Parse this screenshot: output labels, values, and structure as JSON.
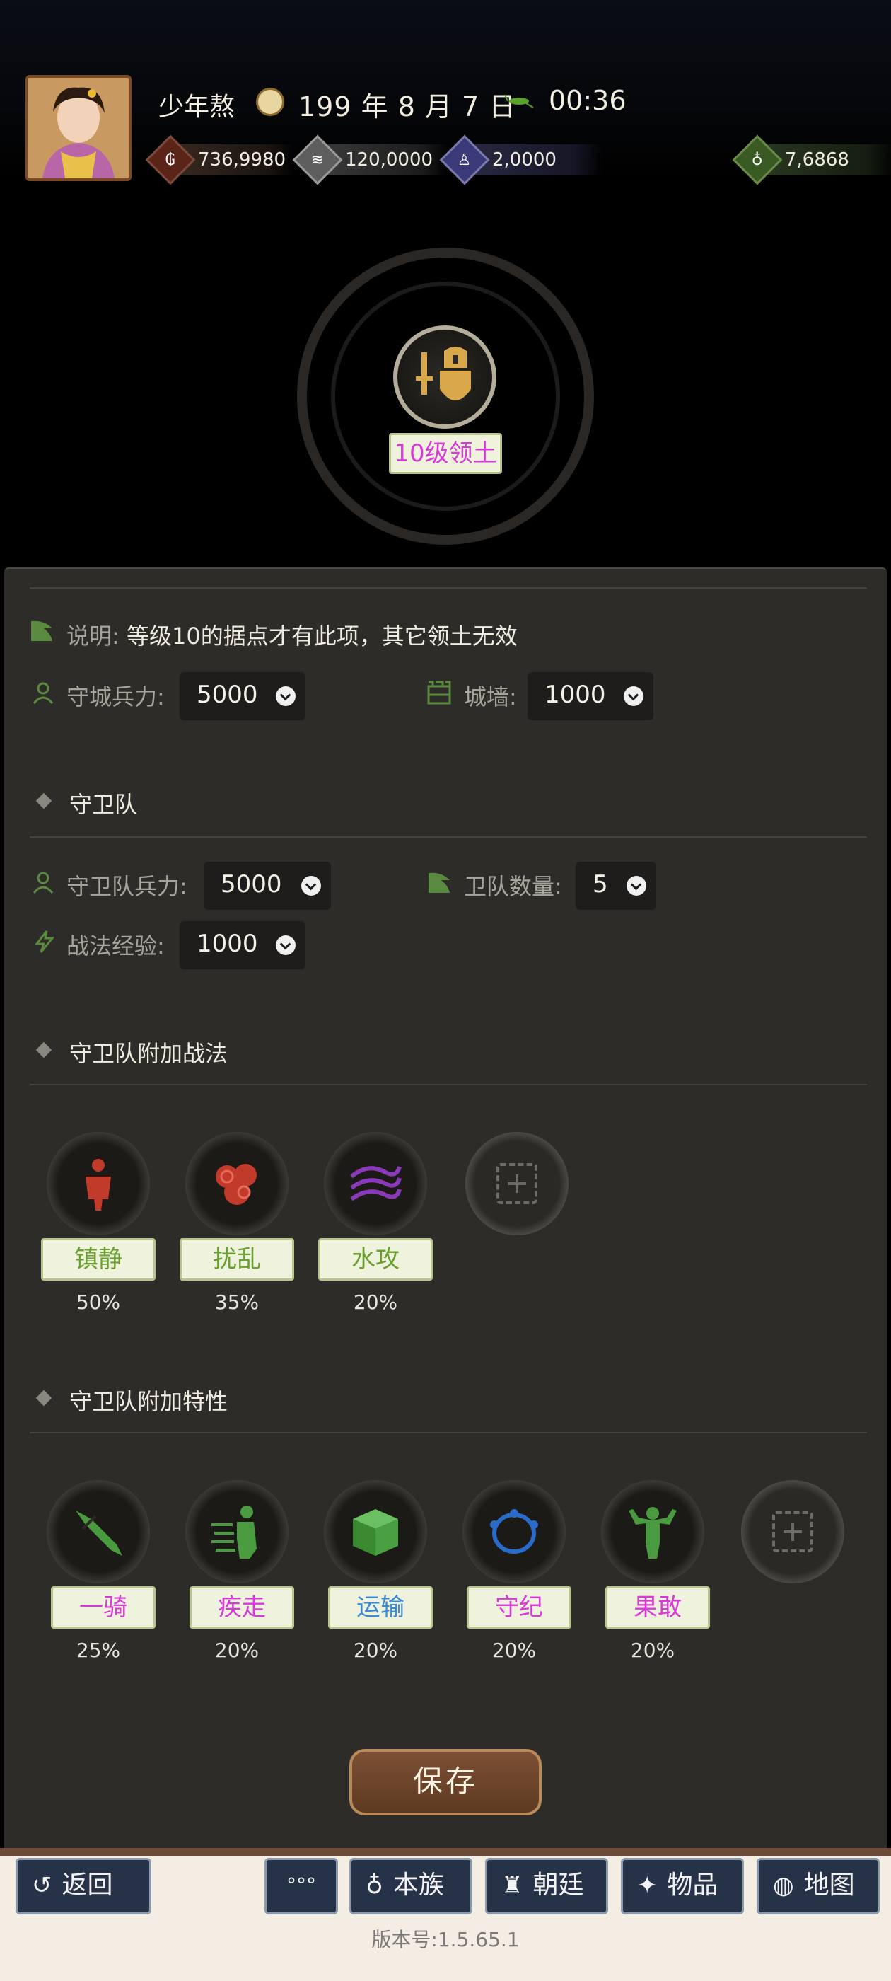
{
  "header": {
    "player_name": "少年熬",
    "date": "199 年 8 月 7 日",
    "time": "00:36",
    "resources": [
      {
        "icon": "coins-icon",
        "value": "736,9980",
        "color": "#8a3a2a"
      },
      {
        "icon": "grain-icon",
        "value": "120,0000",
        "color": "#8c8c8c"
      },
      {
        "icon": "soldier-icon",
        "value": "2,0000",
        "color": "#4a4a8a"
      },
      {
        "icon": "money-bag-icon",
        "value": "7,6868",
        "color": "#4a6a30"
      }
    ],
    "territory_label": "10级领土"
  },
  "panel": {
    "note_label": "说明:",
    "note_text": "等级10的据点才有此项，其它领土无效",
    "city_troops_label": "守城兵力:",
    "city_troops_value": "5000",
    "wall_label": "城墙:",
    "wall_value": "1000",
    "guard_section": "守卫队",
    "guard_troops_label": "守卫队兵力:",
    "guard_troops_value": "5000",
    "guard_count_label": "卫队数量:",
    "guard_count_value": "5",
    "tactic_exp_label": "战法经验:",
    "tactic_exp_value": "1000",
    "tactics_section": "守卫队附加战法",
    "tactics": [
      {
        "name": "镇静",
        "pct": "50%",
        "color": "#6aa030",
        "icon": "calm-figure-icon"
      },
      {
        "name": "扰乱",
        "pct": "35%",
        "color": "#6aa030",
        "icon": "confusion-brain-icon"
      },
      {
        "name": "水攻",
        "pct": "20%",
        "color": "#6aa030",
        "icon": "water-attack-icon"
      }
    ],
    "traits_section": "守卫队附加特性",
    "traits": [
      {
        "name": "一骑",
        "pct": "25%",
        "color": "#d83ad8",
        "icon": "spear-icon"
      },
      {
        "name": "疾走",
        "pct": "20%",
        "color": "#d83ad8",
        "icon": "dash-runner-icon"
      },
      {
        "name": "运输",
        "pct": "20%",
        "color": "#3a8ad8",
        "icon": "cargo-box-icon"
      },
      {
        "name": "守纪",
        "pct": "20%",
        "color": "#d83ad8",
        "icon": "discipline-ring-icon"
      },
      {
        "name": "果敢",
        "pct": "20%",
        "color": "#d83ad8",
        "icon": "strongman-icon"
      }
    ],
    "save_label": "保存"
  },
  "bottom_bar": {
    "back_label": "返回",
    "more_label": "°°°",
    "clan_label": "本族",
    "court_label": "朝廷",
    "items_label": "物品",
    "map_label": "地图",
    "version": "版本号:1.5.65.1"
  }
}
